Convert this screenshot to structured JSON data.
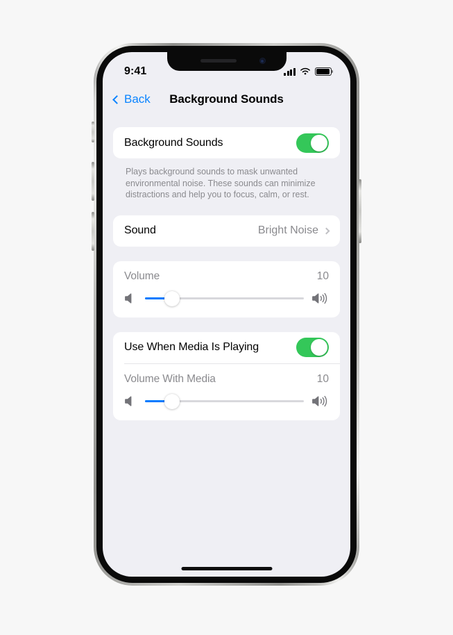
{
  "status_bar": {
    "time": "9:41",
    "cellular_icon": "cellular-signal-icon",
    "wifi_icon": "wifi-icon",
    "battery_icon": "battery-full-icon"
  },
  "nav": {
    "back_label": "Back",
    "title": "Background Sounds"
  },
  "sections": {
    "main_toggle": {
      "label": "Background Sounds",
      "state": "on"
    },
    "description": "Plays background sounds to mask unwanted environmental noise. These sounds can minimize distractions and help you to focus, calm, or rest.",
    "sound_row": {
      "label": "Sound",
      "value": "Bright Noise"
    },
    "volume": {
      "label": "Volume",
      "value": "10",
      "fill_percent": 17
    },
    "media_toggle": {
      "label": "Use When Media Is Playing",
      "state": "on"
    },
    "volume_with_media": {
      "label": "Volume With Media",
      "value": "10",
      "fill_percent": 17
    }
  },
  "colors": {
    "accent_blue": "#007AFF",
    "link_blue": "#0A84FF",
    "toggle_green": "#34C759",
    "screen_background": "#EFEFF4",
    "card_background": "#FFFFFF",
    "secondary_text": "#8A8A8E",
    "page_background": "#F7F7F7"
  }
}
